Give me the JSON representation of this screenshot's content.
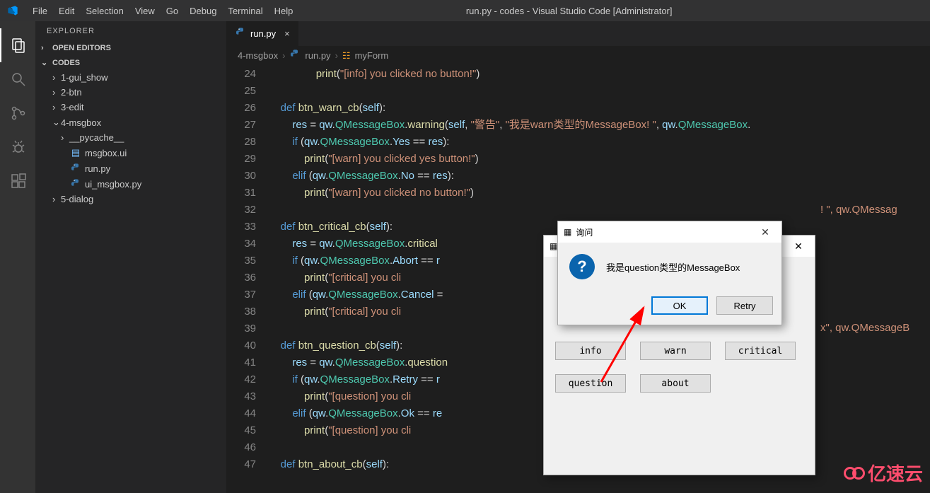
{
  "window": {
    "title": "run.py - codes - Visual Studio Code [Administrator]",
    "menus": [
      "File",
      "Edit",
      "Selection",
      "View",
      "Go",
      "Debug",
      "Terminal",
      "Help"
    ]
  },
  "sidebar": {
    "panel_title": "EXPLORER",
    "open_editors": "OPEN EDITORS",
    "root": "CODES",
    "items": [
      {
        "label": "1-gui_show",
        "type": "folder",
        "expanded": false,
        "indent": 0
      },
      {
        "label": "2-btn",
        "type": "folder",
        "expanded": false,
        "indent": 0
      },
      {
        "label": "3-edit",
        "type": "folder",
        "expanded": false,
        "indent": 0
      },
      {
        "label": "4-msgbox",
        "type": "folder",
        "expanded": true,
        "indent": 0
      },
      {
        "label": "__pycache__",
        "type": "folder",
        "expanded": false,
        "indent": 1
      },
      {
        "label": "msgbox.ui",
        "type": "file-ui",
        "indent": 1
      },
      {
        "label": "run.py",
        "type": "file-py",
        "indent": 1
      },
      {
        "label": "ui_msgbox.py",
        "type": "file-py",
        "indent": 1
      },
      {
        "label": "5-dialog",
        "type": "folder",
        "expanded": false,
        "indent": 0
      }
    ]
  },
  "editor": {
    "tab": {
      "label": "run.py",
      "icon": "python"
    },
    "breadcrumbs": [
      "4-msgbox",
      "run.py",
      "myForm"
    ],
    "first_line_no": 24,
    "lines": [
      {
        "n": 24,
        "html": "                <span class='fn'>print</span><span class='pun'>(</span><span class='str'>\"[info] you clicked no button!\"</span><span class='pun'>)</span>"
      },
      {
        "n": 25,
        "html": ""
      },
      {
        "n": 26,
        "html": "    <span class='kw'>def</span> <span class='fn'>btn_warn_cb</span><span class='pun'>(</span><span class='self'>self</span><span class='pun'>):</span>"
      },
      {
        "n": 27,
        "html": "        <span class='var'>res</span> <span class='op'>=</span> <span class='var'>qw</span><span class='pun'>.</span><span class='cls'>QMessageBox</span><span class='pun'>.</span><span class='fn'>warning</span><span class='pun'>(</span><span class='self'>self</span><span class='pun'>,</span> <span class='str'>\"警告\"</span><span class='pun'>,</span> <span class='str'>\"我是warn类型的MessageBox! \"</span><span class='pun'>,</span> <span class='var'>qw</span><span class='pun'>.</span><span class='cls'>QMessageBox</span><span class='pun'>.</span>"
      },
      {
        "n": 28,
        "html": "        <span class='kw'>if</span> <span class='pun'>(</span><span class='var'>qw</span><span class='pun'>.</span><span class='cls'>QMessageBox</span><span class='pun'>.</span><span class='var'>Yes</span> <span class='op'>==</span> <span class='var'>res</span><span class='pun'>):</span>"
      },
      {
        "n": 29,
        "html": "            <span class='fn'>print</span><span class='pun'>(</span><span class='str'>\"[warn] you clicked yes button!\"</span><span class='pun'>)</span>"
      },
      {
        "n": 30,
        "html": "        <span class='kw'>elif</span> <span class='pun'>(</span><span class='var'>qw</span><span class='pun'>.</span><span class='cls'>QMessageBox</span><span class='pun'>.</span><span class='var'>No</span> <span class='op'>==</span> <span class='var'>res</span><span class='pun'>):</span>"
      },
      {
        "n": 31,
        "html": "            <span class='fn'>print</span><span class='pun'>(</span><span class='str'>\"[warn] you clicked no button!\"</span><span class='pun'>)</span>"
      },
      {
        "n": 32,
        "html": ""
      },
      {
        "n": 33,
        "html": "    <span class='kw'>def</span> <span class='fn'>btn_critical_cb</span><span class='pun'>(</span><span class='self'>self</span><span class='pun'>):</span>"
      },
      {
        "n": 34,
        "html": "        <span class='var'>res</span> <span class='op'>=</span> <span class='var'>qw</span><span class='pun'>.</span><span class='cls'>QMessageBox</span><span class='pun'>.</span><span class='fn'>critical</span>"
      },
      {
        "n": 35,
        "html": "        <span class='kw'>if</span> <span class='pun'>(</span><span class='var'>qw</span><span class='pun'>.</span><span class='cls'>QMessageBox</span><span class='pun'>.</span><span class='var'>Abort</span> <span class='op'>==</span> <span class='var'>r</span>"
      },
      {
        "n": 36,
        "html": "            <span class='fn'>print</span><span class='pun'>(</span><span class='str'>\"[critical] you cli</span>"
      },
      {
        "n": 37,
        "html": "        <span class='kw'>elif</span> <span class='pun'>(</span><span class='var'>qw</span><span class='pun'>.</span><span class='cls'>QMessageBox</span><span class='pun'>.</span><span class='var'>Cancel</span> <span class='op'>=</span>"
      },
      {
        "n": 38,
        "html": "            <span class='fn'>print</span><span class='pun'>(</span><span class='str'>\"[critical] you cli</span>"
      },
      {
        "n": 39,
        "html": ""
      },
      {
        "n": 40,
        "html": "    <span class='kw'>def</span> <span class='fn'>btn_question_cb</span><span class='pun'>(</span><span class='self'>self</span><span class='pun'>):</span>"
      },
      {
        "n": 41,
        "html": "        <span class='var'>res</span> <span class='op'>=</span> <span class='var'>qw</span><span class='pun'>.</span><span class='cls'>QMessageBox</span><span class='pun'>.</span><span class='fn'>question</span>"
      },
      {
        "n": 42,
        "html": "        <span class='kw'>if</span> <span class='pun'>(</span><span class='var'>qw</span><span class='pun'>.</span><span class='cls'>QMessageBox</span><span class='pun'>.</span><span class='var'>Retry</span> <span class='op'>==</span> <span class='var'>r</span>"
      },
      {
        "n": 43,
        "html": "            <span class='fn'>print</span><span class='pun'>(</span><span class='str'>\"[question] you cli</span>"
      },
      {
        "n": 44,
        "html": "        <span class='kw'>elif</span> <span class='pun'>(</span><span class='var'>qw</span><span class='pun'>.</span><span class='cls'>QMessageBox</span><span class='pun'>.</span><span class='var'>Ok</span> <span class='op'>==</span> <span class='var'>re</span>"
      },
      {
        "n": 45,
        "html": "            <span class='fn'>print</span><span class='pun'>(</span><span class='str'>\"[question] you cli</span>"
      },
      {
        "n": 46,
        "html": ""
      },
      {
        "n": 47,
        "html": "    <span class='kw'>def</span> <span class='fn'>btn_about_cb</span><span class='pun'>(</span><span class='self'>self</span><span class='pun'>):</span>"
      }
    ],
    "overflow_right_34": "! \", qw.QMessag",
    "overflow_right_41": "x\", qw.QMessageB"
  },
  "msgbox": {
    "title": "询问",
    "message": "我是question类型的MessageBox",
    "ok": "OK",
    "retry": "Retry"
  },
  "form": {
    "buttons": [
      "info",
      "warn",
      "critical",
      "question",
      "about"
    ]
  },
  "watermark": "亿速云"
}
